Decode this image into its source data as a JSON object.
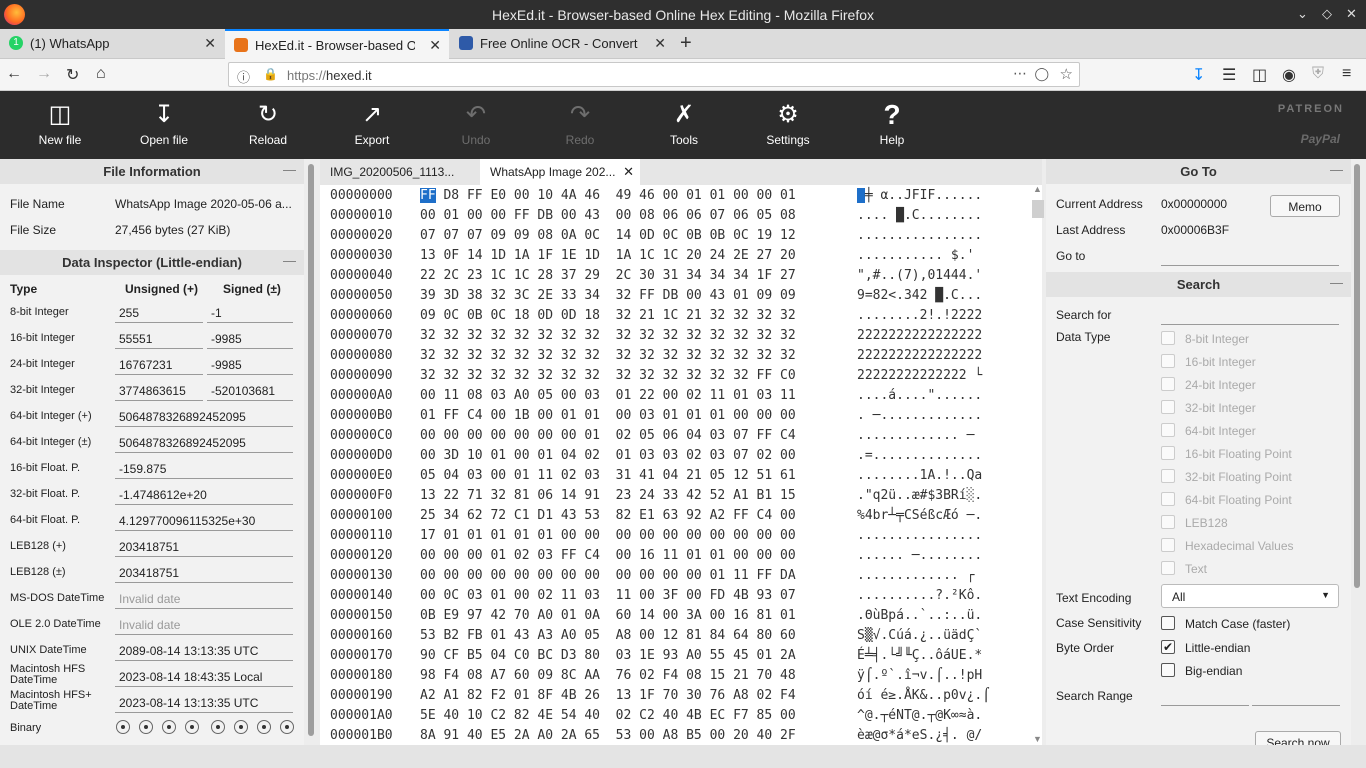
{
  "window": {
    "title": "HexEd.it - Browser-based Online Hex Editing - Mozilla Firefox"
  },
  "tabs": [
    {
      "label": "(1) WhatsApp",
      "badge": "1"
    },
    {
      "label": "HexEd.it - Browser-based O"
    },
    {
      "label": "Free Online OCR - Convert"
    }
  ],
  "nav": {
    "url_prefix": "https://",
    "url_domain": "hexed.it"
  },
  "toolbar": {
    "new_file": "New file",
    "open_file": "Open file",
    "reload": "Reload",
    "export": "Export",
    "undo": "Undo",
    "redo": "Redo",
    "tools": "Tools",
    "settings": "Settings",
    "help": "Help",
    "patreon": "PATREON",
    "paypal": "PayPal"
  },
  "file_info": {
    "title": "File Information",
    "name_label": "File Name",
    "name_value": "WhatsApp Image 2020-05-06 a...",
    "size_label": "File Size",
    "size_value": "27,456 bytes (27 KiB)"
  },
  "inspector": {
    "title": "Data Inspector (Little-endian)",
    "col_type": "Type",
    "col_unsigned": "Unsigned (+)",
    "col_signed": "Signed (±)",
    "rows": [
      {
        "type": "8-bit Integer",
        "u": "255",
        "s": "-1"
      },
      {
        "type": "16-bit Integer",
        "u": "55551",
        "s": "-9985"
      },
      {
        "type": "24-bit Integer",
        "u": "16767231",
        "s": "-9985"
      },
      {
        "type": "32-bit Integer",
        "u": "3774863615",
        "s": "-520103681"
      }
    ],
    "wide": [
      {
        "type": "64-bit Integer (+)",
        "v": "5064878326892452095"
      },
      {
        "type": "64-bit Integer (±)",
        "v": "5064878326892452095"
      },
      {
        "type": "16-bit Float. P.",
        "v": "-159.875"
      },
      {
        "type": "32-bit Float. P.",
        "v": "-1.4748612e+20"
      },
      {
        "type": "64-bit Float. P.",
        "v": "4.129770096115325e+30"
      },
      {
        "type": "LEB128 (+)",
        "v": "203418751"
      },
      {
        "type": "LEB128 (±)",
        "v": "203418751"
      },
      {
        "type": "MS-DOS DateTime",
        "v": "Invalid date"
      },
      {
        "type": "OLE 2.0 DateTime",
        "v": "Invalid date"
      },
      {
        "type": "UNIX DateTime",
        "v": "2089-08-14 13:13:35 UTC"
      },
      {
        "type": "Macintosh HFS DateTime",
        "v": "2023-08-14 18:43:35 Local"
      },
      {
        "type": "Macintosh HFS+ DateTime",
        "v": "2023-08-14 13:13:35 UTC"
      }
    ],
    "binary_label": "Binary"
  },
  "editor_tabs": [
    {
      "label": "IMG_20200506_1113..."
    },
    {
      "label": "WhatsApp Image 202..."
    }
  ],
  "hex": {
    "rows": [
      {
        "addr": "00000000",
        "bytes": "FF D8 FF E0 00 10 4A 46  49 46 00 01 01 00 00 01",
        "ascii": " ╪ α..JFIF......"
      },
      {
        "addr": "00000010",
        "bytes": "00 01 00 00 FF DB 00 43  00 08 06 06 07 06 05 08",
        "ascii": ".... █.C........"
      },
      {
        "addr": "00000020",
        "bytes": "07 07 07 09 09 08 0A 0C  14 0D 0C 0B 0B 0C 19 12",
        "ascii": "................"
      },
      {
        "addr": "00000030",
        "bytes": "13 0F 14 1D 1A 1F 1E 1D  1A 1C 1C 20 24 2E 27 20",
        "ascii": "........... $.' "
      },
      {
        "addr": "00000040",
        "bytes": "22 2C 23 1C 1C 28 37 29  2C 30 31 34 34 34 1F 27",
        "ascii": "\",#..(7),01444.'"
      },
      {
        "addr": "00000050",
        "bytes": "39 3D 38 32 3C 2E 33 34  32 FF DB 00 43 01 09 09",
        "ascii": "9=82<.342 █.C..."
      },
      {
        "addr": "00000060",
        "bytes": "09 0C 0B 0C 18 0D 0D 18  32 21 1C 21 32 32 32 32",
        "ascii": "........2!.!2222"
      },
      {
        "addr": "00000070",
        "bytes": "32 32 32 32 32 32 32 32  32 32 32 32 32 32 32 32",
        "ascii": "2222222222222222"
      },
      {
        "addr": "00000080",
        "bytes": "32 32 32 32 32 32 32 32  32 32 32 32 32 32 32 32",
        "ascii": "2222222222222222"
      },
      {
        "addr": "00000090",
        "bytes": "32 32 32 32 32 32 32 32  32 32 32 32 32 32 FF C0",
        "ascii": "22222222222222 └"
      },
      {
        "addr": "000000A0",
        "bytes": "00 11 08 03 A0 05 00 03  01 22 00 02 11 01 03 11",
        "ascii": "....á....\"......"
      },
      {
        "addr": "000000B0",
        "bytes": "01 FF C4 00 1B 00 01 01  00 03 01 01 01 00 00 00",
        "ascii": ". ─............."
      },
      {
        "addr": "000000C0",
        "bytes": "00 00 00 00 00 00 00 01  02 05 06 04 03 07 FF C4",
        "ascii": "............. ─"
      },
      {
        "addr": "000000D0",
        "bytes": "00 3D 10 01 00 01 04 02  01 03 03 02 03 07 02 00",
        "ascii": ".=.............."
      },
      {
        "addr": "000000E0",
        "bytes": "05 04 03 00 01 11 02 03  31 41 04 21 05 12 51 61",
        "ascii": "........1A.!..Qa"
      },
      {
        "addr": "000000F0",
        "bytes": "13 22 71 32 81 06 14 91  23 24 33 42 52 A1 B1 15",
        "ascii": ".\"q2ü..æ#$3BRí░."
      },
      {
        "addr": "00000100",
        "bytes": "25 34 62 72 C1 D1 43 53  82 E1 63 92 A2 FF C4 00",
        "ascii": "%4br┴╤CSéßcÆó ─."
      },
      {
        "addr": "00000110",
        "bytes": "17 01 01 01 01 01 00 00  00 00 00 00 00 00 00 00",
        "ascii": "................"
      },
      {
        "addr": "00000120",
        "bytes": "00 00 00 01 02 03 FF C4  00 16 11 01 01 00 00 00",
        "ascii": "...... ─........"
      },
      {
        "addr": "00000130",
        "bytes": "00 00 00 00 00 00 00 00  00 00 00 00 01 11 FF DA",
        "ascii": "............. ┌"
      },
      {
        "addr": "00000140",
        "bytes": "00 0C 03 01 00 02 11 03  11 00 3F 00 FD 4B 93 07",
        "ascii": "..........?.²Kô."
      },
      {
        "addr": "00000150",
        "bytes": "0B E9 97 42 70 A0 01 0A  60 14 00 3A 00 16 81 01",
        "ascii": ".ΘùBpá..`..:..ü."
      },
      {
        "addr": "00000160",
        "bytes": "53 B2 FB 01 43 A3 A0 05  A8 00 12 81 84 64 80 60",
        "ascii": "S▒√.Cúá.¿..üädÇ`"
      },
      {
        "addr": "00000170",
        "bytes": "90 CF B5 04 C0 BC D3 80  03 1E 93 A0 55 45 01 2A",
        "ascii": "É╧╡.└╝╙Ç..ôáUE.*"
      },
      {
        "addr": "00000180",
        "bytes": "98 F4 08 A7 60 09 8C AA  76 02 F4 08 15 21 70 48",
        "ascii": "ÿ⌠.º`.î¬v.⌠..!pH"
      },
      {
        "addr": "00000190",
        "bytes": "A2 A1 82 F2 01 8F 4B 26  13 1F 70 30 76 A8 02 F4",
        "ascii": "óí é≥.ÅK&..p0v¿.⌠"
      },
      {
        "addr": "000001A0",
        "bytes": "5E 40 10 C2 82 4E 54 40  02 C2 40 4B EC F7 85 00",
        "ascii": "^@.┬éNT@.┬@K∞≈à."
      },
      {
        "addr": "000001B0",
        "bytes": "8A 91 40 E5 2A A0 2A 65  53 00 A8 B5 00 20 40 2F",
        "ascii": "èæ@σ*á*eS.¿╡. @/"
      }
    ]
  },
  "goto": {
    "title": "Go To",
    "current_label": "Current Address",
    "current_value": "0x00000000",
    "last_label": "Last Address",
    "last_value": "0x00006B3F",
    "goto_label": "Go to",
    "memo": "Memo"
  },
  "search": {
    "title": "Search",
    "search_for": "Search for",
    "data_type": "Data Type",
    "types": [
      "8-bit Integer",
      "16-bit Integer",
      "24-bit Integer",
      "32-bit Integer",
      "64-bit Integer",
      "16-bit Floating Point",
      "32-bit Floating Point",
      "64-bit Floating Point",
      "LEB128",
      "Hexadecimal Values",
      "Text"
    ],
    "text_encoding_label": "Text Encoding",
    "text_encoding_value": "All",
    "case_label": "Case Sensitivity",
    "case_option": "Match Case (faster)",
    "byte_order_label": "Byte Order",
    "little": "Little-endian",
    "big": "Big-endian",
    "range_label": "Search Range",
    "search_now": "Search now"
  }
}
